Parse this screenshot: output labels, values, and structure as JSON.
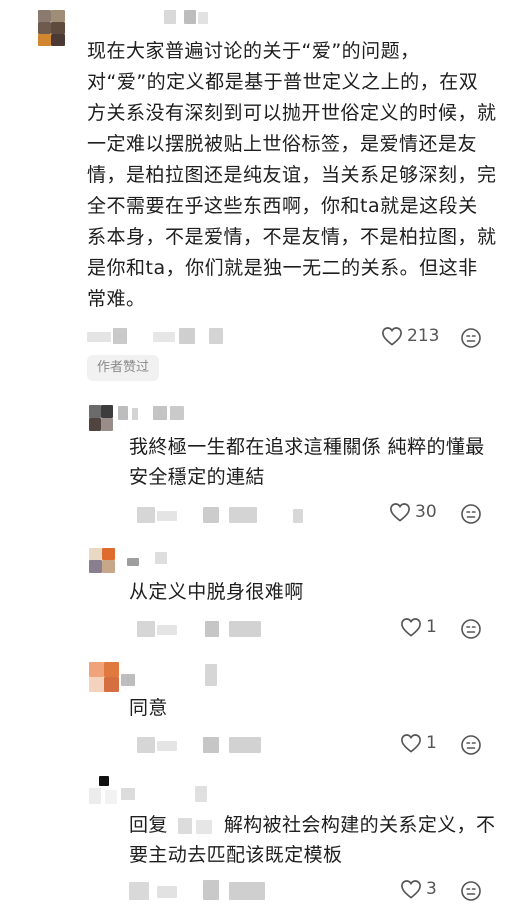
{
  "main_comment": {
    "text": "现在大家普遍讨论的关于“爱”的问题，对“爱”的定义都是基于普世定义之上的，在双方关系没有深刻到可以抛开世俗定义的时候，就一定难以摆脱被贴上世俗标签，是爱情还是友情，是柏拉图还是纯友谊，当关系足够深刻，完全不需要在乎这些东西啊，你和ta就是这段关系本身，不是爱情，不是友情，不是柏拉图，就是你和ta，你们就是独一无二的关系。但这非常难。",
    "likes": "213",
    "author_liked_badge": "作者赞过"
  },
  "replies": [
    {
      "text": "我終極一生都在追求這種關係 純粹的懂最安全穩定的連結",
      "likes": "30"
    },
    {
      "text": "从定义中脱身很难啊",
      "likes": "1"
    },
    {
      "text": "同意",
      "likes": "1"
    },
    {
      "reply_prefix": "回复",
      "text": "解构被社会构建的关系定义，不要主动去匹配该既定模板",
      "likes": "3"
    }
  ],
  "icons": {
    "like": "heart-outline-icon",
    "react": "emoji-face-icon"
  },
  "colors": {
    "text": "#1e1e1e",
    "meta": "#555555",
    "badge_bg": "#f1f1f1",
    "badge_text": "#8a8a8a"
  }
}
